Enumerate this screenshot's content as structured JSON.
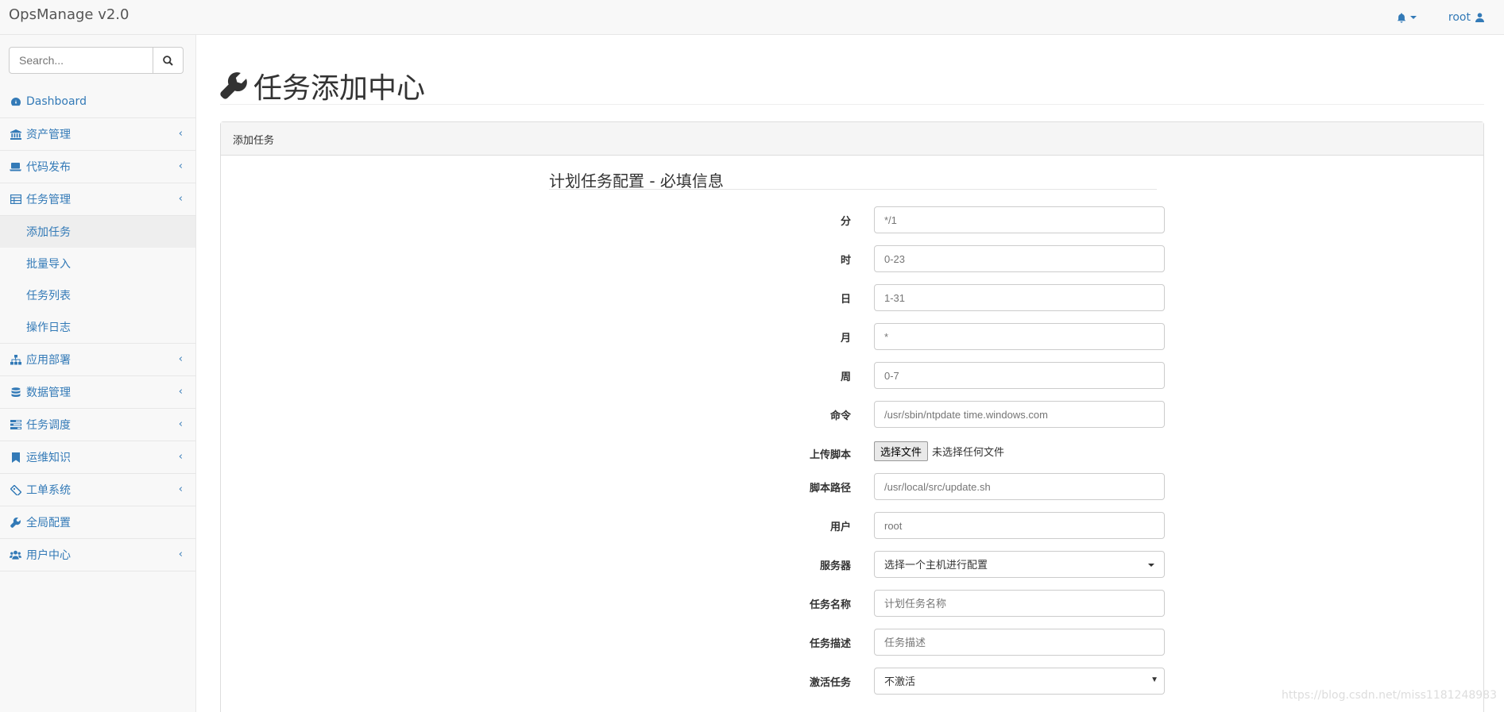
{
  "navbar": {
    "brand": "OpsManage v2.0",
    "user_label": "root"
  },
  "sidebar": {
    "search_placeholder": "Search...",
    "items": [
      {
        "label": "Dashboard",
        "icon": "dashboard-icon"
      },
      {
        "label": "资产管理",
        "icon": "bank-icon"
      },
      {
        "label": "代码发布",
        "icon": "laptop-icon"
      },
      {
        "label": "任务管理",
        "icon": "table-icon"
      },
      {
        "label": "应用部署",
        "icon": "sitemap-icon"
      },
      {
        "label": "数据管理",
        "icon": "database-icon"
      },
      {
        "label": "任务调度",
        "icon": "tasks-icon"
      },
      {
        "label": "运维知识",
        "icon": "bookmark-icon"
      },
      {
        "label": "工单系统",
        "icon": "ticket-icon"
      },
      {
        "label": "全局配置",
        "icon": "wrench-icon"
      },
      {
        "label": "用户中心",
        "icon": "users-icon"
      }
    ],
    "task_submenu": [
      {
        "label": "添加任务",
        "active": true
      },
      {
        "label": "批量导入"
      },
      {
        "label": "任务列表"
      },
      {
        "label": "操作日志"
      }
    ]
  },
  "main": {
    "page_title": "任务添加中心",
    "panel_heading": "添加任务",
    "legend": "计划任务配置 - 必填信息",
    "fields": [
      {
        "label": "分",
        "placeholder": "*/1"
      },
      {
        "label": "时",
        "placeholder": "0-23"
      },
      {
        "label": "日",
        "placeholder": "1-31"
      },
      {
        "label": "月",
        "placeholder": "*"
      },
      {
        "label": "周",
        "placeholder": "0-7"
      },
      {
        "label": "命令",
        "placeholder": "/usr/sbin/ntpdate time.windows.com"
      },
      {
        "label": "上传脚本",
        "file_button": "选择文件",
        "file_status": "未选择任何文件"
      },
      {
        "label": "脚本路径",
        "placeholder": "/usr/local/src/update.sh"
      },
      {
        "label": "用户",
        "placeholder": "root"
      },
      {
        "label": "服务器",
        "selected": "选择一个主机进行配置"
      },
      {
        "label": "任务名称",
        "placeholder": "计划任务名称"
      },
      {
        "label": "任务描述",
        "placeholder": "任务描述"
      },
      {
        "label": "激活任务",
        "selected": "不激活"
      }
    ]
  },
  "watermark": "https://blog.csdn.net/miss1181248983"
}
